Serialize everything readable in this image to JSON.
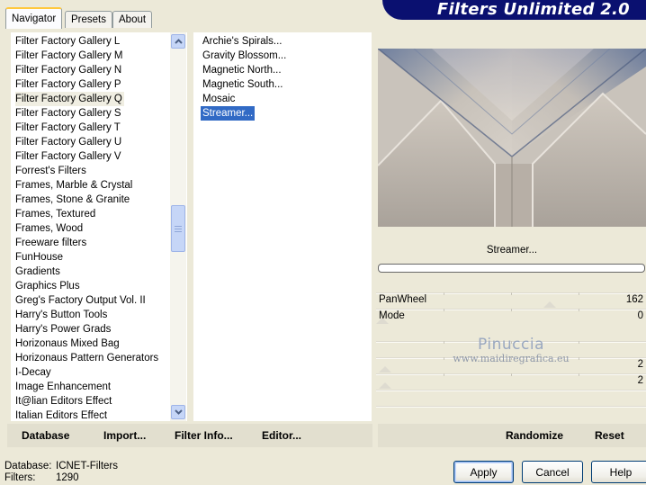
{
  "tabs": [
    {
      "label": "Navigator",
      "active": true
    },
    {
      "label": "Presets",
      "active": false
    },
    {
      "label": "About",
      "active": false
    }
  ],
  "app_title": "Filters Unlimited 2.0",
  "categories": [
    "Filter Factory Gallery L",
    "Filter Factory Gallery M",
    "Filter Factory Gallery N",
    "Filter Factory Gallery P",
    "Filter Factory Gallery Q",
    "Filter Factory Gallery S",
    "Filter Factory Gallery T",
    "Filter Factory Gallery U",
    "Filter Factory Gallery V",
    "Forrest's Filters",
    "Frames, Marble & Crystal",
    "Frames, Stone & Granite",
    "Frames, Textured",
    "Frames, Wood",
    "Freeware filters",
    "FunHouse",
    "Gradients",
    "Graphics Plus",
    "Greg's Factory Output Vol. II",
    "Harry's Button Tools",
    "Harry's Power Grads",
    "Horizonaus Mixed Bag",
    "Horizonaus Pattern Generators",
    "I-Decay",
    "Image Enhancement",
    "It@lian Editors Effect",
    "Italian Editors Effect"
  ],
  "selected_category": "Filter Factory Gallery Q",
  "filters": [
    "Archie's Spirals...",
    "Gravity Blossom...",
    "Magnetic North...",
    "Magnetic South...",
    "Mosaic",
    "Streamer..."
  ],
  "selected_filter": "Streamer...",
  "current_filter_name": "Streamer...",
  "parameters": [
    {
      "label": "PanWheel",
      "value": "162",
      "level": 0.64
    },
    {
      "label": "Mode",
      "value": "0",
      "level": 0.0
    },
    {
      "label": "",
      "value": "",
      "level": null
    },
    {
      "label": "",
      "value": "2",
      "level": 0.01
    },
    {
      "label": "",
      "value": "2",
      "level": 0.01
    }
  ],
  "watermark": {
    "title": "Pinuccia",
    "url": "www.maidiregrafica.eu"
  },
  "bottom_left_buttons": [
    "Database",
    "Import...",
    "Filter Info...",
    "Editor..."
  ],
  "bottom_right_buttons": [
    "Randomize",
    "Reset"
  ],
  "status": {
    "database_label": "Database:",
    "database_value": "ICNET-Filters",
    "filters_label": "Filters:",
    "filters_value": "1290"
  },
  "dialog_buttons": {
    "apply": "Apply",
    "cancel": "Cancel",
    "help": "Help"
  },
  "colors": {
    "title_banner": "#0a1070",
    "selection": "#316ac5",
    "window_bg": "#ece9d8",
    "tab_highlight": "#ffc83c"
  },
  "icons": {
    "scroll_up": "chevron-up-icon",
    "scroll_down": "chevron-down-icon"
  }
}
